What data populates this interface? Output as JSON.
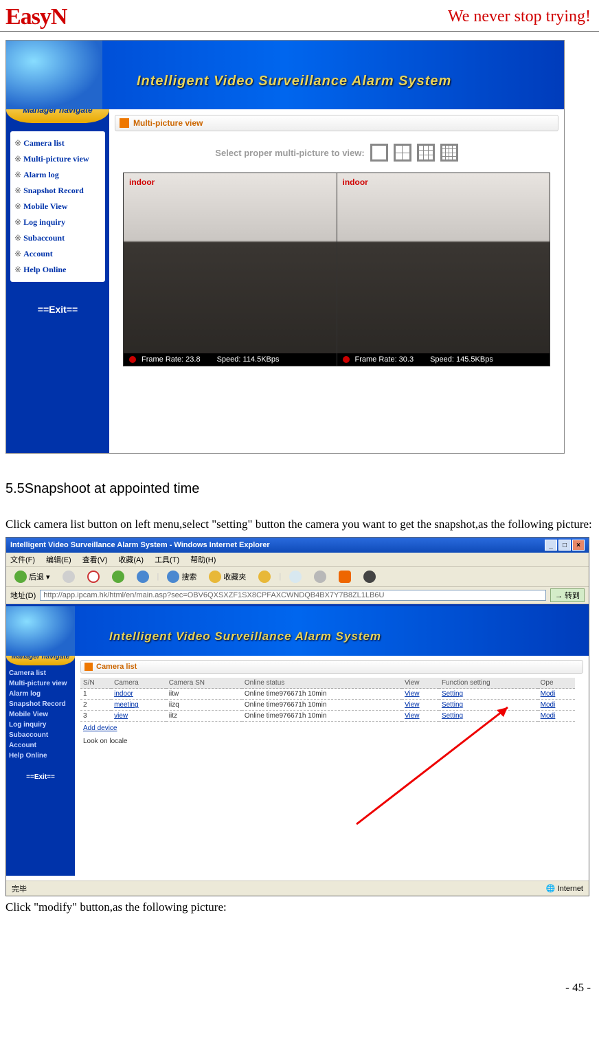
{
  "header": {
    "logo": "EasyN",
    "tagline": "We never stop trying!"
  },
  "figure1": {
    "banner_title": "Intelligent  Video  Surveillance  Alarm  System",
    "sidebar_header": "Manager navigate",
    "menu": [
      "Camera list",
      "Multi-picture view",
      "Alarm log",
      "Snapshot Record",
      "Mobile View",
      "Log inquiry",
      "Subaccount",
      "Account",
      "Help Online"
    ],
    "exit": "==Exit==",
    "section_title": "Multi-picture view",
    "select_label": "Select proper multi-picture to view:",
    "cam1": {
      "label": "indoor",
      "frame": "Frame Rate: 23.8",
      "speed": "Speed: 114.5KBps"
    },
    "cam2": {
      "label": "indoor",
      "frame": "Frame Rate: 30.3",
      "speed": "Speed: 145.5KBps"
    }
  },
  "section_heading": "5.5Snapshoot at appointed time",
  "para1": "Click camera list button on left menu,select \"setting\" button the camera you want to get the snapshot,as the following picture:",
  "para2": "Click \"modify\" button,as the following picture:",
  "figure2": {
    "window_title": "Intelligent Video Surveillance Alarm System - Windows Internet Explorer",
    "menu": [
      "文件(F)",
      "编辑(E)",
      "查看(V)",
      "收藏(A)",
      "工具(T)",
      "帮助(H)"
    ],
    "tb_back": "后退",
    "tb_search": "搜索",
    "tb_fav": "收藏夹",
    "addr_label": "地址(D)",
    "url": "http://app.ipcam.hk/html/en/main.asp?sec=OBV6QXSXZF1SX8CPFAXCWNDQB4BX7Y7B8ZL1LB6U",
    "go": "转到",
    "banner_title": "Intelligent  Video  Surveillance  Alarm  System",
    "sidebar_header": "Manager navigate",
    "sidebar": [
      "Camera list",
      "Multi-picture view",
      "Alarm log",
      "Snapshot Record",
      "Mobile View",
      "Log inquiry",
      "Subaccount",
      "Account",
      "Help Online"
    ],
    "exit": "==Exit==",
    "section_title": "Camera list",
    "table": {
      "cols": [
        "S/N",
        "Camera",
        "Camera SN",
        "Online status",
        "View",
        "Function setting",
        "Ope"
      ],
      "rows": [
        {
          "sn": "1",
          "camera": "indoor",
          "camsn": "iitw",
          "status": "Online time976671h 10min",
          "view": "View",
          "setting": "Setting",
          "ope": "Modi"
        },
        {
          "sn": "2",
          "camera": "meeting",
          "camsn": "iizq",
          "status": "Online time976671h 10min",
          "view": "View",
          "setting": "Setting",
          "ope": "Modi"
        },
        {
          "sn": "3",
          "camera": "view",
          "camsn": "iitz",
          "status": "Online time976671h 10min",
          "view": "View",
          "setting": "Setting",
          "ope": "Modi"
        }
      ]
    },
    "add_device": "Add device",
    "look_locale": "Look on locale",
    "status_left": "完毕",
    "status_right": "Internet"
  },
  "page_number": "- 45 -"
}
